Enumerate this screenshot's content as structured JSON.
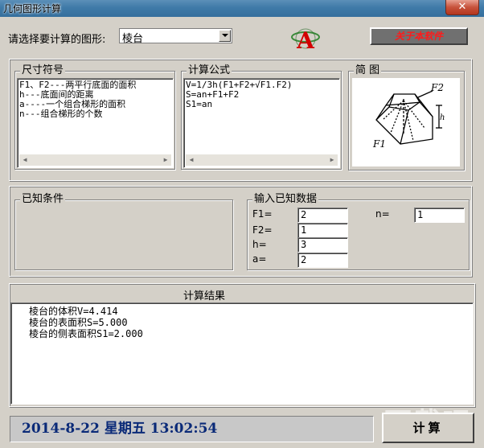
{
  "window": {
    "title": "几何图形计算",
    "close_glyph": "✕"
  },
  "selector": {
    "label": "请选择要计算的图形:",
    "value": "棱台"
  },
  "logo": {
    "letter": "A"
  },
  "about_button": {
    "label": "关于本软件"
  },
  "symbols": {
    "title": "尺寸符号",
    "lines": [
      "F1、F2---两平行底面的面积",
      "h---底面间的距离",
      "a----一个组合梯形的面积",
      "n---组合梯形的个数"
    ]
  },
  "formula": {
    "title": "计算公式",
    "lines": [
      "V=1/3h(F1+F2+√F1.F2)",
      "S=an+F1+F2",
      "S1=an"
    ]
  },
  "diagram": {
    "title": "简  图",
    "labels": {
      "f2": "F2",
      "f1": "F1",
      "h": "h"
    }
  },
  "known": {
    "title": "已知条件"
  },
  "inputs": {
    "title": "输入已知数据",
    "fields": [
      {
        "label": "F1=",
        "value": "2"
      },
      {
        "label": "F2=",
        "value": "1"
      },
      {
        "label": "h=",
        "value": "3"
      },
      {
        "label": "a=",
        "value": "2"
      },
      {
        "label": "n=",
        "value": "1"
      }
    ]
  },
  "result": {
    "title": "计算结果",
    "lines": [
      "棱台的体积V=4.414",
      "棱台的表面积S=5.000",
      "棱台的侧表面积S1=2.000"
    ]
  },
  "status": {
    "datetime": "2014-8-22  星期五  13:02:54"
  },
  "calc_button": {
    "label": "计算"
  },
  "watermark": {
    "text": "下载吧"
  },
  "colors": {
    "about_text": "#ff1a1a",
    "date_text": "#0a2a78",
    "logo_red": "#d40000"
  }
}
